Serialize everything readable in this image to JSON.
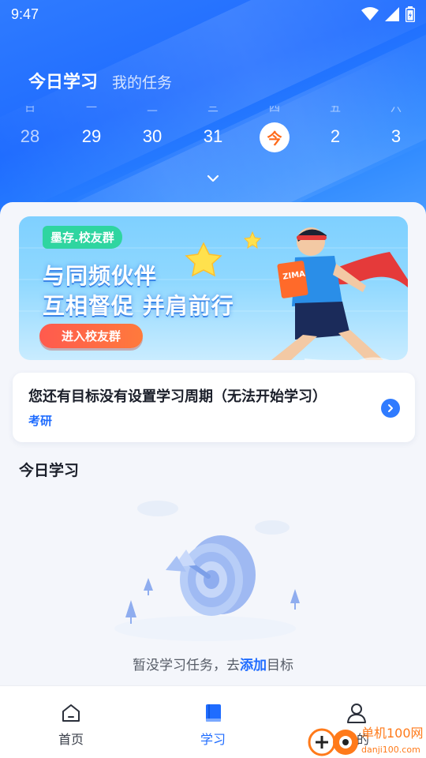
{
  "status_bar": {
    "time": "9:47"
  },
  "header": {
    "tabs": [
      {
        "label": "今日学习",
        "active": true
      },
      {
        "label": "我的任务",
        "active": false
      }
    ],
    "week": [
      {
        "day": "28"
      },
      {
        "day": "29"
      },
      {
        "day": "30"
      },
      {
        "day": "31"
      },
      {
        "day": "今",
        "today": true
      },
      {
        "day": "2"
      },
      {
        "day": "3"
      }
    ]
  },
  "banner": {
    "tag": "墨存.校友群",
    "line1": "与同频伙伴",
    "line2": "互相督促 并肩前行",
    "button": "进入校友群",
    "book_text": "ZIMA"
  },
  "goal_card": {
    "title": "您还有目标没有设置学习周期（无法开始学习）",
    "subtitle": "考研"
  },
  "today_section": {
    "title": "今日学习",
    "empty_prefix": "暂没学习任务，去",
    "empty_link": "添加",
    "empty_suffix": "目标"
  },
  "bottom_nav": [
    {
      "label": "首页",
      "icon": "home-icon",
      "active": false
    },
    {
      "label": "学习",
      "icon": "book-icon",
      "active": true
    },
    {
      "label": "我的",
      "icon": "profile-icon",
      "active": false
    }
  ],
  "watermark": {
    "cn": "单机100网",
    "url": "danji100.com"
  },
  "colors": {
    "primary": "#1f6cff",
    "today_accent": "#ff6a1a",
    "banner_tag": "#2fd5a0"
  }
}
